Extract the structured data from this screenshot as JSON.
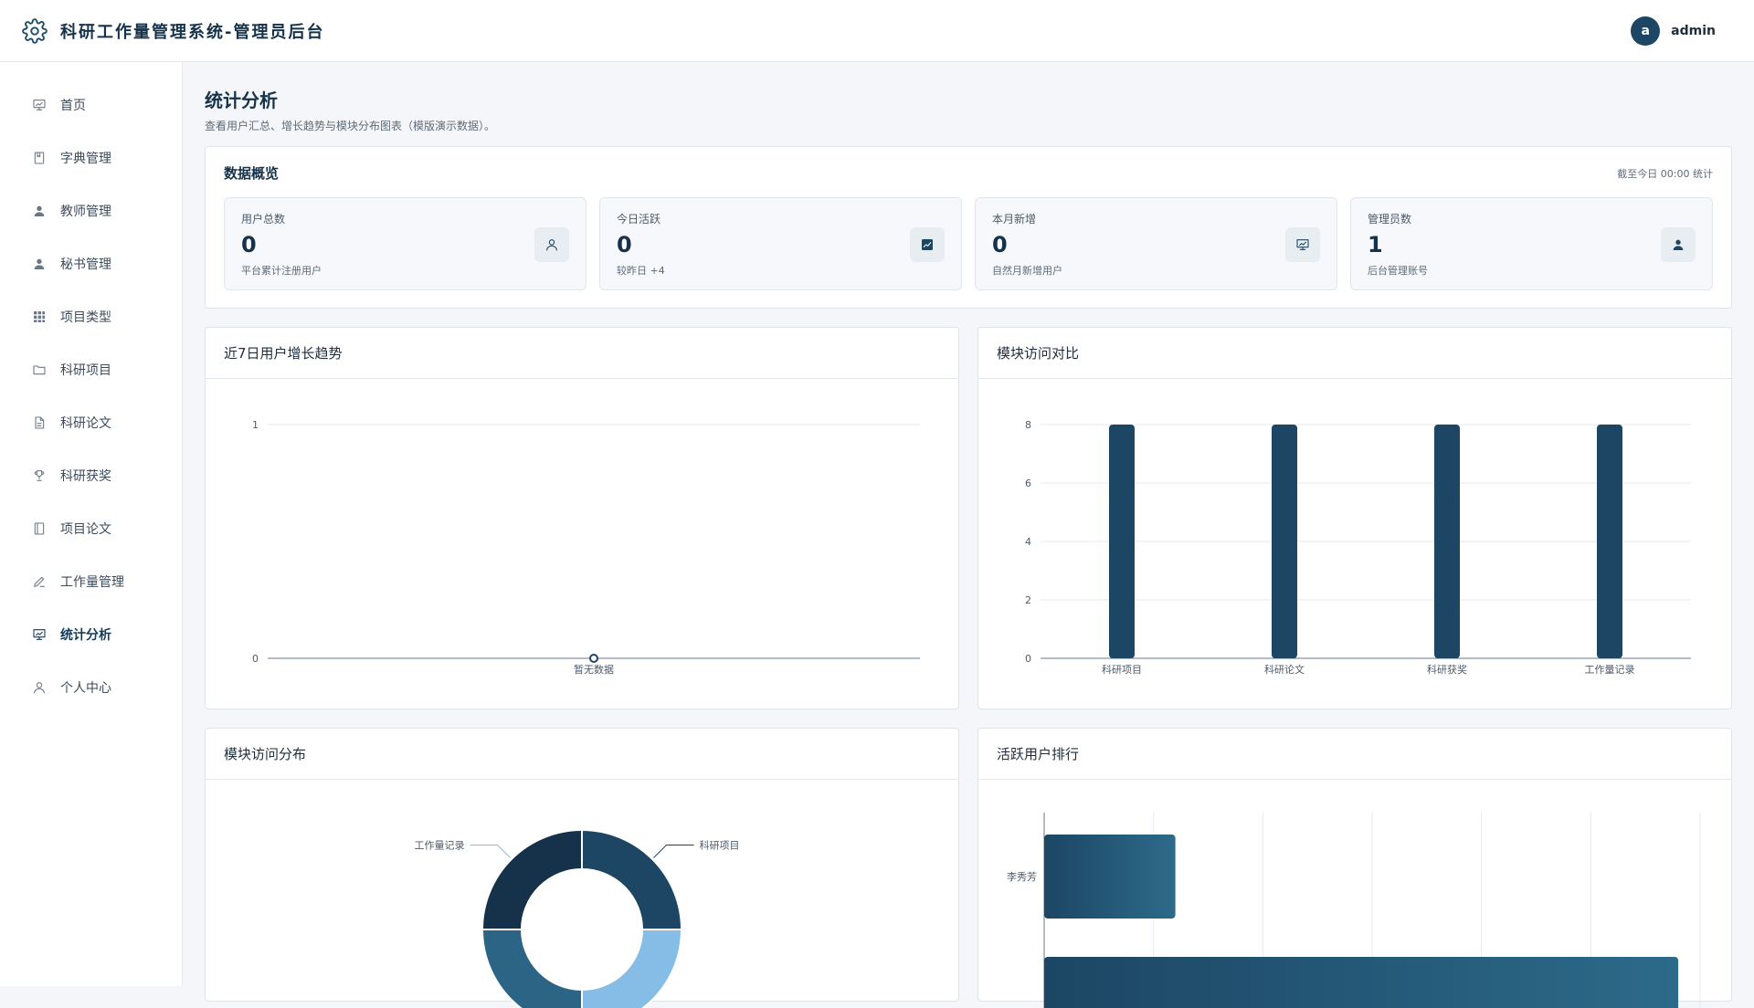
{
  "app": {
    "title": "科研工作量管理系统-管理员后台"
  },
  "user": {
    "avatar_letter": "a",
    "name": "admin"
  },
  "sidebar": {
    "items": [
      {
        "label": "首页",
        "icon": "presentation-icon",
        "active": false
      },
      {
        "label": "字典管理",
        "icon": "book-icon",
        "active": false
      },
      {
        "label": "教师管理",
        "icon": "user-icon",
        "active": false
      },
      {
        "label": "秘书管理",
        "icon": "user-icon",
        "active": false
      },
      {
        "label": "项目类型",
        "icon": "grid-icon",
        "active": false
      },
      {
        "label": "科研项目",
        "icon": "folder-icon",
        "active": false
      },
      {
        "label": "科研论文",
        "icon": "document-icon",
        "active": false
      },
      {
        "label": "科研获奖",
        "icon": "trophy-icon",
        "active": false
      },
      {
        "label": "项目论文",
        "icon": "notebook-icon",
        "active": false
      },
      {
        "label": "工作量管理",
        "icon": "pen-icon",
        "active": false
      },
      {
        "label": "统计分析",
        "icon": "presentation-icon",
        "active": true
      },
      {
        "label": "个人中心",
        "icon": "user-outline-icon",
        "active": false
      }
    ]
  },
  "page": {
    "title": "统计分析",
    "description": "查看用户汇总、增长趋势与模块分布图表（模版演示数据）。"
  },
  "overview": {
    "title": "数据概览",
    "note": "截至今日 00:00 统计",
    "stats": [
      {
        "label": "用户总数",
        "value": "0",
        "sub": "平台累计注册用户",
        "icon": "user-outline-icon"
      },
      {
        "label": "今日活跃",
        "value": "0",
        "sub": "较昨日 +4",
        "icon": "chart-line-icon"
      },
      {
        "label": "本月新增",
        "value": "0",
        "sub": "自然月新增用户",
        "icon": "presentation-icon"
      },
      {
        "label": "管理员数",
        "value": "1",
        "sub": "后台管理账号",
        "icon": "user-icon"
      }
    ]
  },
  "panels": {
    "growth": {
      "title": "近7日用户增长趋势"
    },
    "module_compare": {
      "title": "模块访问对比"
    },
    "module_dist": {
      "title": "模块访问分布"
    },
    "active_rank": {
      "title": "活跃用户排行"
    }
  },
  "chart_data": [
    {
      "type": "line",
      "categories": [
        "暂无数据"
      ],
      "series": [
        {
          "values": [
            0
          ]
        }
      ],
      "ylim": [
        0,
        1
      ],
      "yticks": [
        0,
        1
      ],
      "color": "#1c4664"
    },
    {
      "type": "bar",
      "categories": [
        "科研项目",
        "科研论文",
        "科研获奖",
        "工作量记录"
      ],
      "values": [
        8,
        8,
        8,
        8
      ],
      "ylim": [
        0,
        8
      ],
      "yticks": [
        0,
        2,
        4,
        6,
        8
      ],
      "color": "#1c4664"
    },
    {
      "type": "pie",
      "labels": [
        "科研项目",
        "工作量记录"
      ],
      "colors": [
        "#1c4664",
        "#85bde6",
        "#2b6485",
        "#16324a"
      ],
      "values": [
        25,
        25,
        25,
        25
      ]
    },
    {
      "type": "bar",
      "orientation": "horizontal",
      "categories": [
        "李秀芳"
      ],
      "values": [
        1.2,
        5.8
      ],
      "xlim": [
        0,
        6
      ],
      "colors": [
        "#1c4664",
        "#2d6a8a"
      ]
    }
  ]
}
